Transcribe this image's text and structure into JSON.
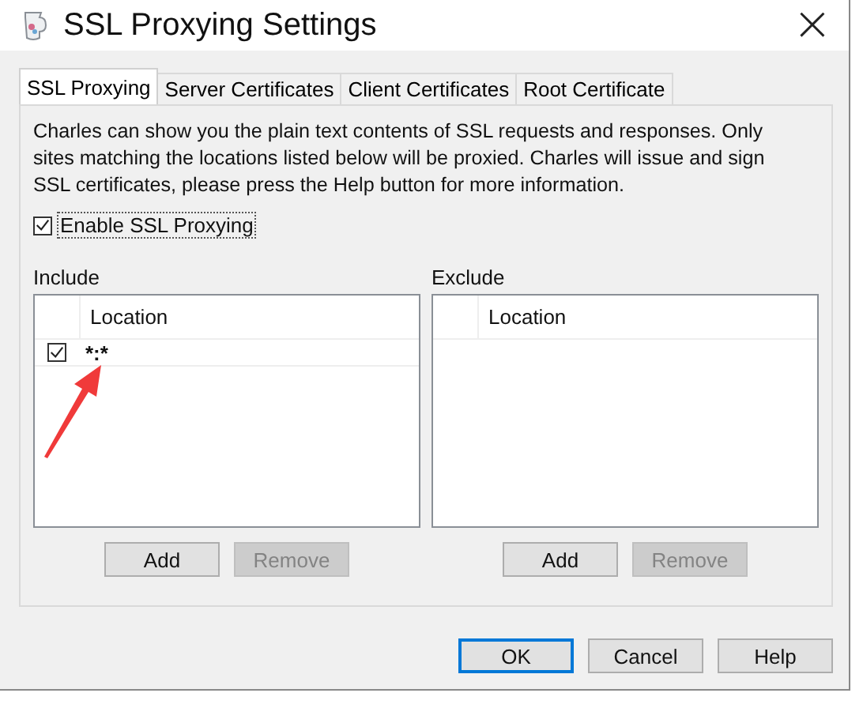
{
  "window": {
    "title": "SSL Proxying Settings",
    "close": "×"
  },
  "tabs": [
    {
      "label": "SSL Proxying",
      "selected": true
    },
    {
      "label": "Server Certificates",
      "selected": false
    },
    {
      "label": "Client Certificates",
      "selected": false
    },
    {
      "label": "Root Certificate",
      "selected": false
    }
  ],
  "description": "Charles can show you the plain text contents of SSL requests and responses. Only sites matching the locations listed below will be proxied. Charles will issue and sign SSL certificates, please press the Help button for more information.",
  "enable_ssl_proxying": {
    "label": "Enable SSL Proxying",
    "checked": true
  },
  "lists": [
    {
      "label": "Include",
      "column": "Location",
      "rows": [
        {
          "checked": true,
          "location": "*:*"
        }
      ],
      "buttons": [
        {
          "label": "Add",
          "disabled": false
        },
        {
          "label": "Remove",
          "disabled": true
        }
      ]
    },
    {
      "label": "Exclude",
      "column": "Location",
      "buttons": [
        {
          "label": "Add",
          "disabled": false
        },
        {
          "label": "Remove",
          "disabled": true
        }
      ]
    }
  ],
  "dialog_buttons": [
    {
      "label": "OK",
      "default": true
    },
    {
      "label": "Cancel",
      "default": false
    },
    {
      "label": "Help",
      "default": false
    }
  ]
}
